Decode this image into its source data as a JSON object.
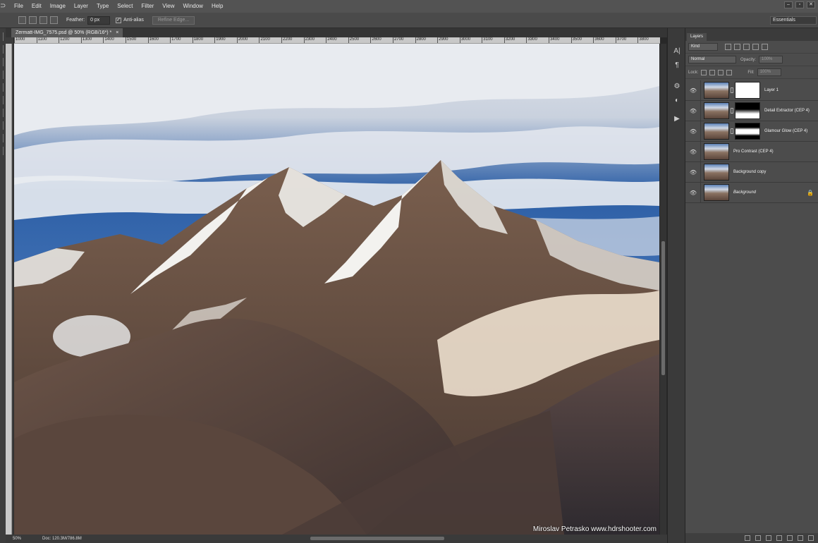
{
  "menubar": {
    "logo_icon": "photoshop-icon",
    "items": [
      "File",
      "Edit",
      "Image",
      "Layer",
      "Type",
      "Select",
      "Filter",
      "View",
      "Window",
      "Help"
    ],
    "window_controls": [
      "–",
      "▫",
      "✕"
    ]
  },
  "options_bar": {
    "feather_label": "Feather:",
    "feather_value": "0 px",
    "antialias_label": "Anti-alias",
    "antialias_checked": "✓",
    "refine_edge_label": "Refine Edge...",
    "workspace": "Essentials"
  },
  "document": {
    "tab_title": "Zermatt-IMG_7575.psd @ 50% (RGB/16*) *",
    "tab_close": "×",
    "zoom": "50%",
    "doc_size": "Doc: 120.3M/786.8M",
    "watermark": "Miroslav  Petrasko  www.hdrshooter.com"
  },
  "ruler": {
    "ticks": [
      "1000",
      "1100",
      "1200",
      "1300",
      "1400",
      "1500",
      "1600",
      "1700",
      "1800",
      "1900",
      "2000",
      "2100",
      "2200",
      "2300",
      "2400",
      "2500",
      "2600",
      "2700",
      "2800",
      "2900",
      "3000",
      "3100",
      "3200",
      "3300",
      "3400",
      "3500",
      "3600",
      "3700",
      "3800"
    ]
  },
  "layers_panel": {
    "tab_label": "Layers",
    "filter_kind": "Kind",
    "blend_mode": "Normal",
    "opacity_label": "Opacity:",
    "opacity_value": "100%",
    "lock_label": "Lock:",
    "fill_label": "Fill:",
    "fill_value": "100%",
    "layers": [
      {
        "name": "Layer 1",
        "has_mask": true,
        "mask_type": "white",
        "italic": false,
        "locked": false
      },
      {
        "name": "Detail Extractor  (CEP 4)",
        "has_mask": true,
        "mask_type": "mountain",
        "italic": false,
        "locked": false
      },
      {
        "name": "Glamour Glow (CEP 4)",
        "has_mask": true,
        "mask_type": "band",
        "italic": false,
        "locked": false
      },
      {
        "name": "Pro Contrast (CEP 4)",
        "has_mask": false,
        "italic": false,
        "locked": false
      },
      {
        "name": "Background copy",
        "has_mask": false,
        "italic": false,
        "locked": false
      },
      {
        "name": "Background",
        "has_mask": false,
        "italic": true,
        "locked": true
      }
    ]
  },
  "colors": {
    "sky": "#2f62a8",
    "cloud": "#e6e9ee",
    "rock": "#6e5647",
    "snow": "#f4efe6",
    "panel": "#4c4c4c"
  }
}
